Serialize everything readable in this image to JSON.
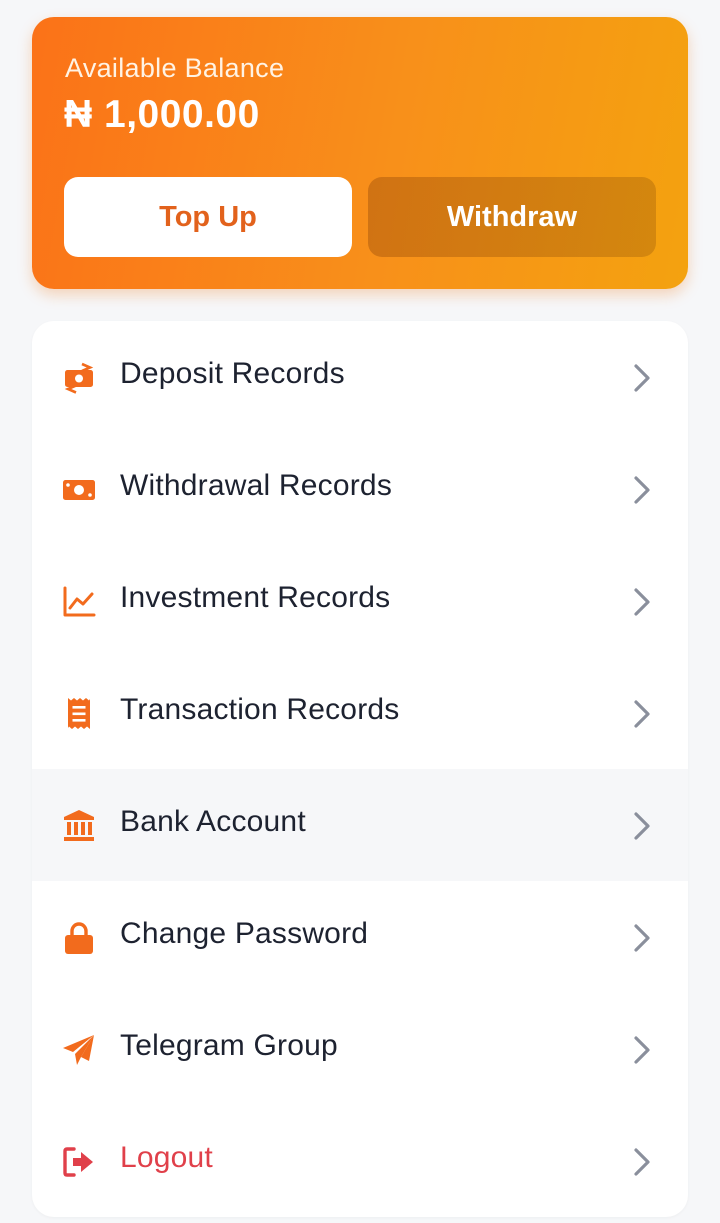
{
  "colors": {
    "accent": "#f97316",
    "icon": "#f26b1d",
    "danger": "#e0404a",
    "chevron": "#8a8f9c",
    "text": "#1d2230"
  },
  "balance": {
    "label": "Available Balance",
    "amount": "₦ 1,000.00"
  },
  "actions": {
    "topup_label": "Top Up",
    "withdraw_label": "Withdraw"
  },
  "menu": {
    "items": [
      {
        "label": "Deposit Records",
        "icon": "money-transfer-icon"
      },
      {
        "label": "Withdrawal Records",
        "icon": "money-bill-icon"
      },
      {
        "label": "Investment Records",
        "icon": "line-chart-icon"
      },
      {
        "label": "Transaction Records",
        "icon": "receipt-icon"
      },
      {
        "label": "Bank Account",
        "icon": "bank-icon",
        "highlighted": true
      },
      {
        "label": "Change Password",
        "icon": "lock-icon"
      },
      {
        "label": "Telegram Group",
        "icon": "paper-plane-icon"
      },
      {
        "label": "Logout",
        "icon": "logout-icon",
        "danger": true
      }
    ]
  }
}
